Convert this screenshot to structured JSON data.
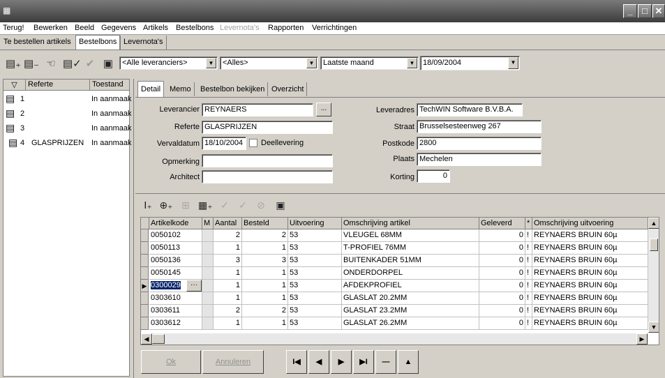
{
  "window": {
    "system_icon": "app-icon",
    "buttons": [
      "minimize-icon",
      "maximize-icon",
      "close-icon"
    ]
  },
  "menubar": {
    "items": [
      {
        "label": "Terug!",
        "enabled": true
      },
      {
        "label": "Bewerken",
        "enabled": true
      },
      {
        "label": "Beeld",
        "enabled": true
      },
      {
        "label": "Gegevens",
        "enabled": true
      },
      {
        "label": "Artikels",
        "enabled": true
      },
      {
        "label": "Bestelbons",
        "enabled": true
      },
      {
        "label": "Levernota's",
        "enabled": false
      },
      {
        "label": "Rapporten",
        "enabled": true
      },
      {
        "label": "Verrichtingen",
        "enabled": true
      }
    ]
  },
  "outer_tabs": [
    {
      "label": "Te bestellen artikels",
      "active": false
    },
    {
      "label": "Bestelbons",
      "active": true
    },
    {
      "label": "Levernota's",
      "active": false
    }
  ],
  "toolbar": {
    "filter_supplier": "<Alle leveranciers>",
    "filter_status": "<Alles>",
    "filter_period": "Laatste maand",
    "filter_date": "18/09/2004"
  },
  "left_list": {
    "headers": {
      "sort": "▽",
      "referte": "Referte",
      "toestand": "Toestand"
    },
    "rows": [
      {
        "num": "1",
        "ref": "",
        "status": "In aanmaak"
      },
      {
        "num": "2",
        "ref": "",
        "status": "In aanmaak"
      },
      {
        "num": "3",
        "ref": "",
        "status": "In aanmaak"
      },
      {
        "num": "4",
        "ref": "GLASPRIJZEN",
        "status": "In aanmaak"
      }
    ]
  },
  "inner_tabs": [
    {
      "label": "Detail",
      "active": true
    },
    {
      "label": "Memo",
      "active": false
    },
    {
      "label": "Bestelbon bekijken",
      "active": false
    },
    {
      "label": "Overzicht",
      "active": false
    }
  ],
  "form": {
    "leverancier_label": "Leverancier",
    "leverancier": "REYNAERS",
    "lookup_label": "...",
    "referte_label": "Referte",
    "referte": "GLASPRIJZEN",
    "vervaldatum_label": "Vervaldatum",
    "vervaldatum": "18/10/2004",
    "deellevering_label": "Deellevering",
    "opmerking_label": "Opmerking",
    "opmerking": "",
    "architect_label": "Architect",
    "architect": "",
    "leveradres_label": "Leveradres",
    "leveradres": "TechWIN Software B.V.B.A.",
    "straat_label": "Straat",
    "straat": "Brusselsesteenweg 267",
    "postkode_label": "Postkode",
    "postkode": "2800",
    "plaats_label": "Plaats",
    "plaats": "Mechelen",
    "korting_label": "Korting",
    "korting": "0"
  },
  "grid": {
    "headers": {
      "artikelkode": "Artikelkode",
      "m": "M",
      "aantal": "Aantal",
      "besteld": "Besteld",
      "uitvoering": "Uitvoering",
      "omschrijving": "Omschrijving artikel",
      "geleverd": "Geleverd",
      "star": "*",
      "omschrijving_uitv": "Omschrijving uitvoering"
    },
    "rows": [
      {
        "code": "0050102",
        "aantal": "2",
        "besteld": "2",
        "uitv": "53",
        "omschr": "VLEUGEL 68MM",
        "geleverd": "0",
        "flag": "!",
        "uitv_omschr": "REYNAERS BRUIN 60µ"
      },
      {
        "code": "0050113",
        "aantal": "1",
        "besteld": "1",
        "uitv": "53",
        "omschr": "T-PROFIEL 76MM",
        "geleverd": "0",
        "flag": "!",
        "uitv_omschr": "REYNAERS BRUIN 60µ"
      },
      {
        "code": "0050136",
        "aantal": "3",
        "besteld": "3",
        "uitv": "53",
        "omschr": "BUITENKADER 51MM",
        "geleverd": "0",
        "flag": "!",
        "uitv_omschr": "REYNAERS BRUIN 60µ"
      },
      {
        "code": "0050145",
        "aantal": "1",
        "besteld": "1",
        "uitv": "53",
        "omschr": "ONDERDORPEL",
        "geleverd": "0",
        "flag": "!",
        "uitv_omschr": "REYNAERS BRUIN 60µ"
      },
      {
        "code": "0300029",
        "aantal": "1",
        "besteld": "1",
        "uitv": "53",
        "omschr": "AFDEKPROFIEL",
        "geleverd": "0",
        "flag": "!",
        "uitv_omschr": "REYNAERS BRUIN 60µ"
      },
      {
        "code": "0303610",
        "aantal": "1",
        "besteld": "1",
        "uitv": "53",
        "omschr": "GLASLAT 20.2MM",
        "geleverd": "0",
        "flag": "!",
        "uitv_omschr": "REYNAERS BRUIN 60µ"
      },
      {
        "code": "0303611",
        "aantal": "2",
        "besteld": "2",
        "uitv": "53",
        "omschr": "GLASLAT 23.2MM",
        "geleverd": "0",
        "flag": "!",
        "uitv_omschr": "REYNAERS BRUIN 60µ"
      },
      {
        "code": "0303612",
        "aantal": "1",
        "besteld": "1",
        "uitv": "53",
        "omschr": "GLASLAT 26.2MM",
        "geleverd": "0",
        "flag": "!",
        "uitv_omschr": "REYNAERS BRUIN 60µ"
      }
    ],
    "current_row": 4,
    "ellipsis": "···"
  },
  "buttons": {
    "ok": "Ok",
    "annuleren": "Annuleren",
    "nav_first": "I◀",
    "nav_prev": "◀",
    "nav_next": "▶",
    "nav_last": "▶I",
    "nav_delete": "—",
    "nav_up": "▲"
  }
}
